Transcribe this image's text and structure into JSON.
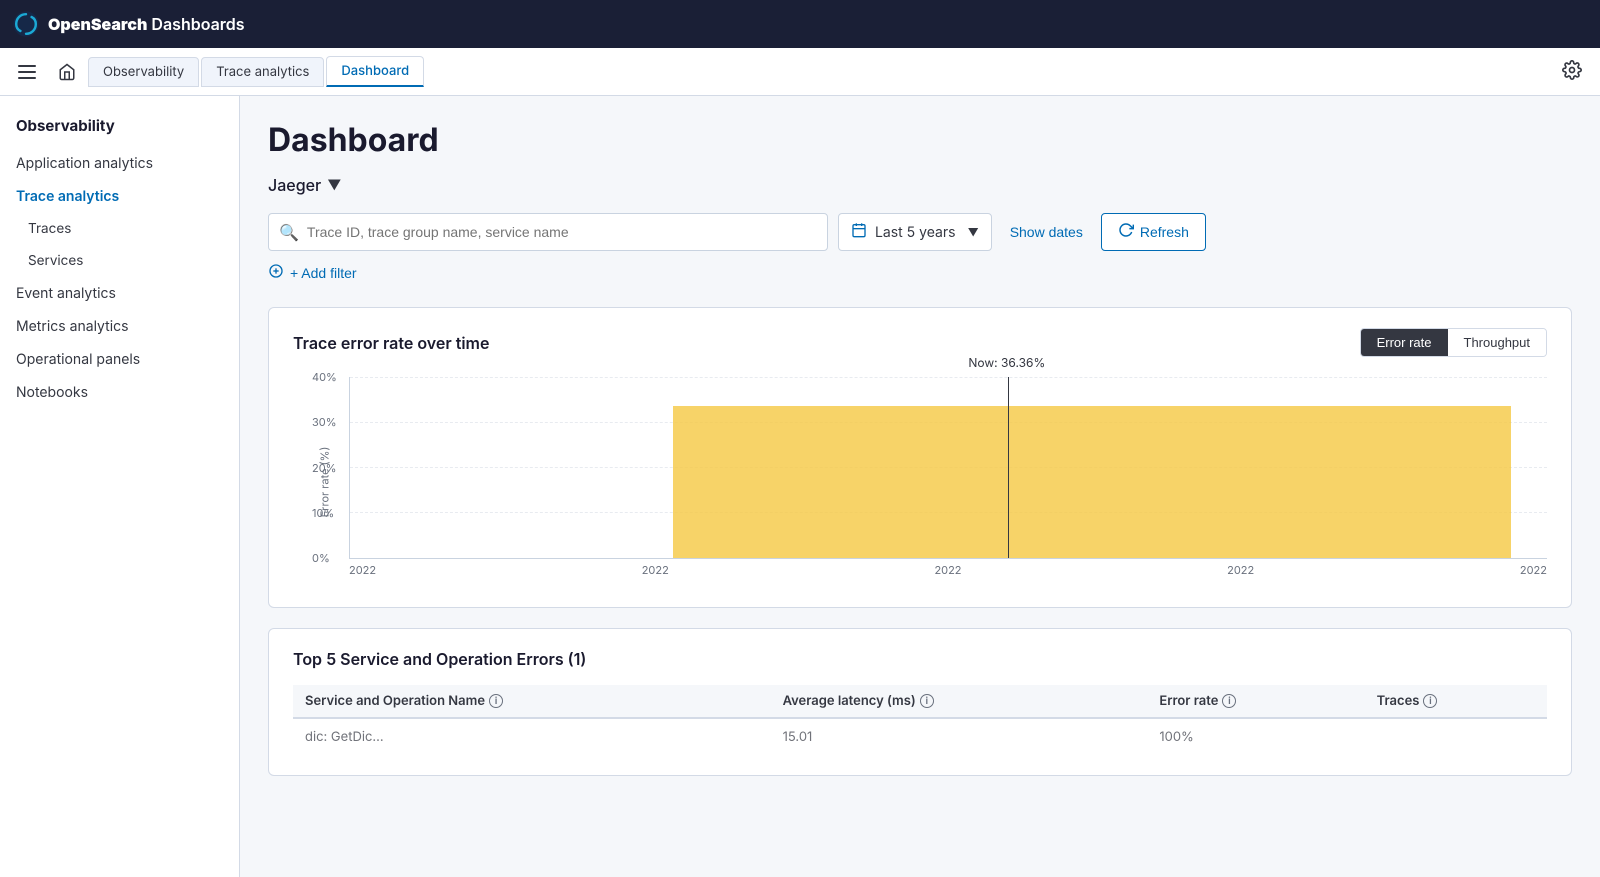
{
  "topbar": {
    "logo_text": "OpenSearch Dashboards",
    "logo_bold": "OpenSearch",
    "logo_light": " Dashboards"
  },
  "breadcrumb": {
    "items": [
      {
        "label": "Observability",
        "active": false
      },
      {
        "label": "Trace analytics",
        "active": false
      },
      {
        "label": "Dashboard",
        "active": true
      }
    ]
  },
  "sidebar": {
    "section_title": "Observability",
    "items": [
      {
        "label": "Application analytics",
        "active": false,
        "sub": false
      },
      {
        "label": "Trace analytics",
        "active": true,
        "sub": false
      },
      {
        "label": "Traces",
        "active": false,
        "sub": true
      },
      {
        "label": "Services",
        "active": false,
        "sub": true
      },
      {
        "label": "Event analytics",
        "active": false,
        "sub": false
      },
      {
        "label": "Metrics analytics",
        "active": false,
        "sub": false
      },
      {
        "label": "Operational panels",
        "active": false,
        "sub": false
      },
      {
        "label": "Notebooks",
        "active": false,
        "sub": false
      }
    ]
  },
  "page": {
    "title": "Dashboard",
    "service_name": "Jaeger",
    "search_placeholder": "Trace ID, trace group name, service name",
    "date_range": "Last 5 years",
    "show_dates_label": "Show dates",
    "refresh_label": "Refresh",
    "add_filter_label": "+ Add filter"
  },
  "chart": {
    "title": "Trace error rate over time",
    "toggle_buttons": [
      {
        "label": "Error rate",
        "active": true
      },
      {
        "label": "Throughput",
        "active": false
      }
    ],
    "y_axis_label": "Error rate (%)",
    "y_ticks": [
      {
        "label": "40%",
        "pct": 100
      },
      {
        "label": "30%",
        "pct": 75
      },
      {
        "label": "20%",
        "pct": 50
      },
      {
        "label": "10%",
        "pct": 25
      },
      {
        "label": "0%",
        "pct": 0
      }
    ],
    "x_labels": [
      "2022",
      "2022",
      "2022",
      "2022",
      "2022"
    ],
    "now_label": "Now: 36.36%",
    "bar_color": "#f5c842",
    "bar_start_pct": 28,
    "bar_width_pct": 75,
    "now_line_pct": 55
  },
  "table": {
    "title": "Top 5 Service and Operation Errors (1)",
    "columns": [
      {
        "label": "Service and Operation Name",
        "info": true,
        "key": "name"
      },
      {
        "label": "Average latency (ms)",
        "info": true,
        "key": "latency"
      },
      {
        "label": "Error rate",
        "info": true,
        "key": "error_rate"
      },
      {
        "label": "Traces",
        "info": true,
        "key": "traces"
      }
    ],
    "rows": [
      {
        "name": "dic: GetDic...",
        "latency": "15.01",
        "error_rate": "100%",
        "traces": ""
      }
    ]
  }
}
